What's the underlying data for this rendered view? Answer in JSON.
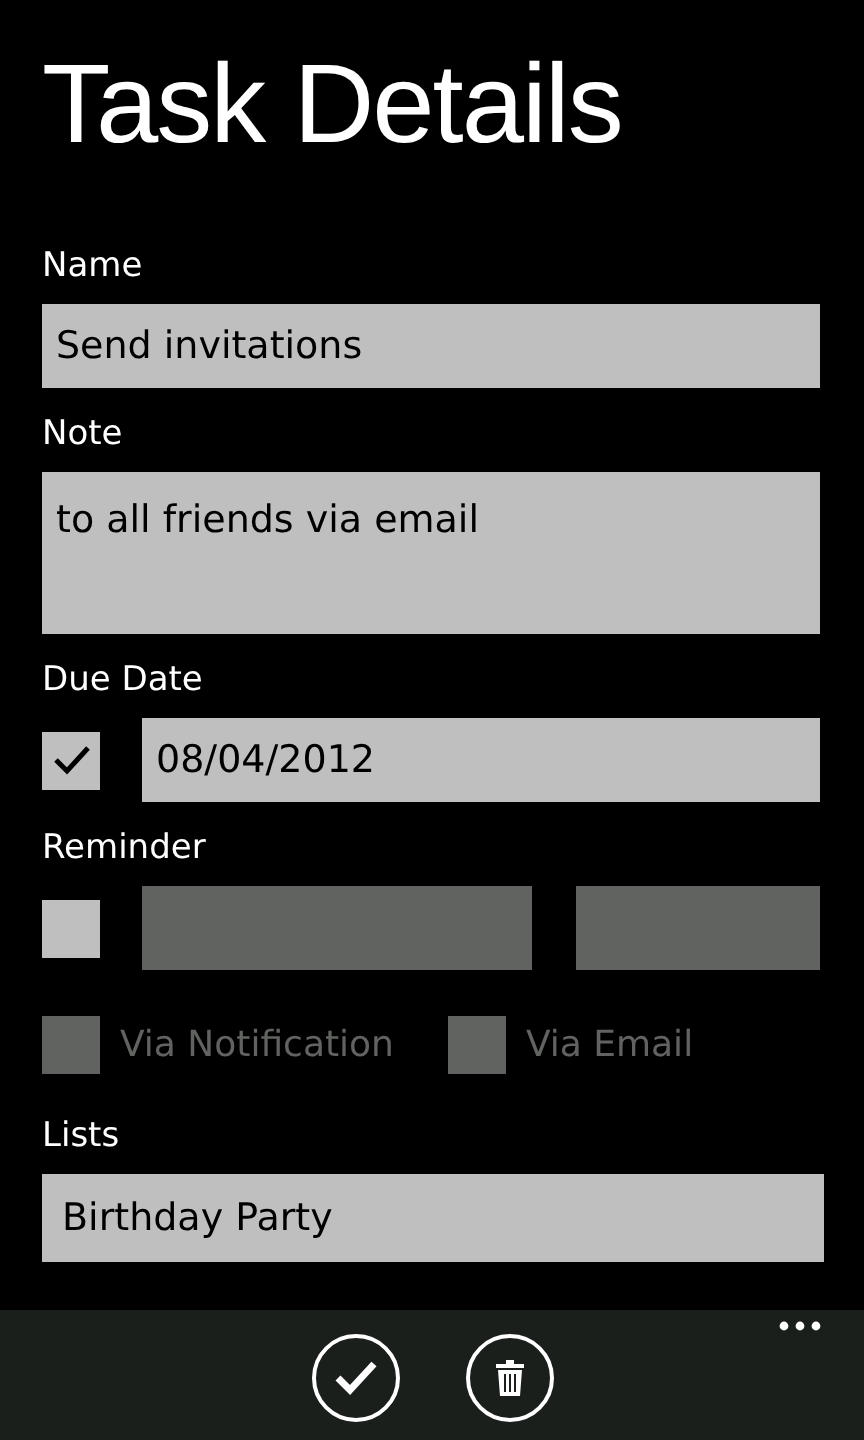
{
  "title": "Task Details",
  "name": {
    "label": "Name",
    "value": "Send invitations"
  },
  "note": {
    "label": "Note",
    "value": "to all friends via email"
  },
  "due_date": {
    "label": "Due Date",
    "checked": true,
    "value": "08/04/2012"
  },
  "reminder": {
    "label": "Reminder",
    "checked": false,
    "disabled": true
  },
  "reminder_options": [
    {
      "label": "Via Notification",
      "checked": false,
      "disabled": true
    },
    {
      "label": "Via Email",
      "checked": false,
      "disabled": true
    }
  ],
  "lists": {
    "label": "Lists",
    "value": "Birthday Party"
  },
  "app_bar": {
    "buttons": [
      {
        "kind": "check"
      },
      {
        "kind": "delete"
      }
    ]
  }
}
